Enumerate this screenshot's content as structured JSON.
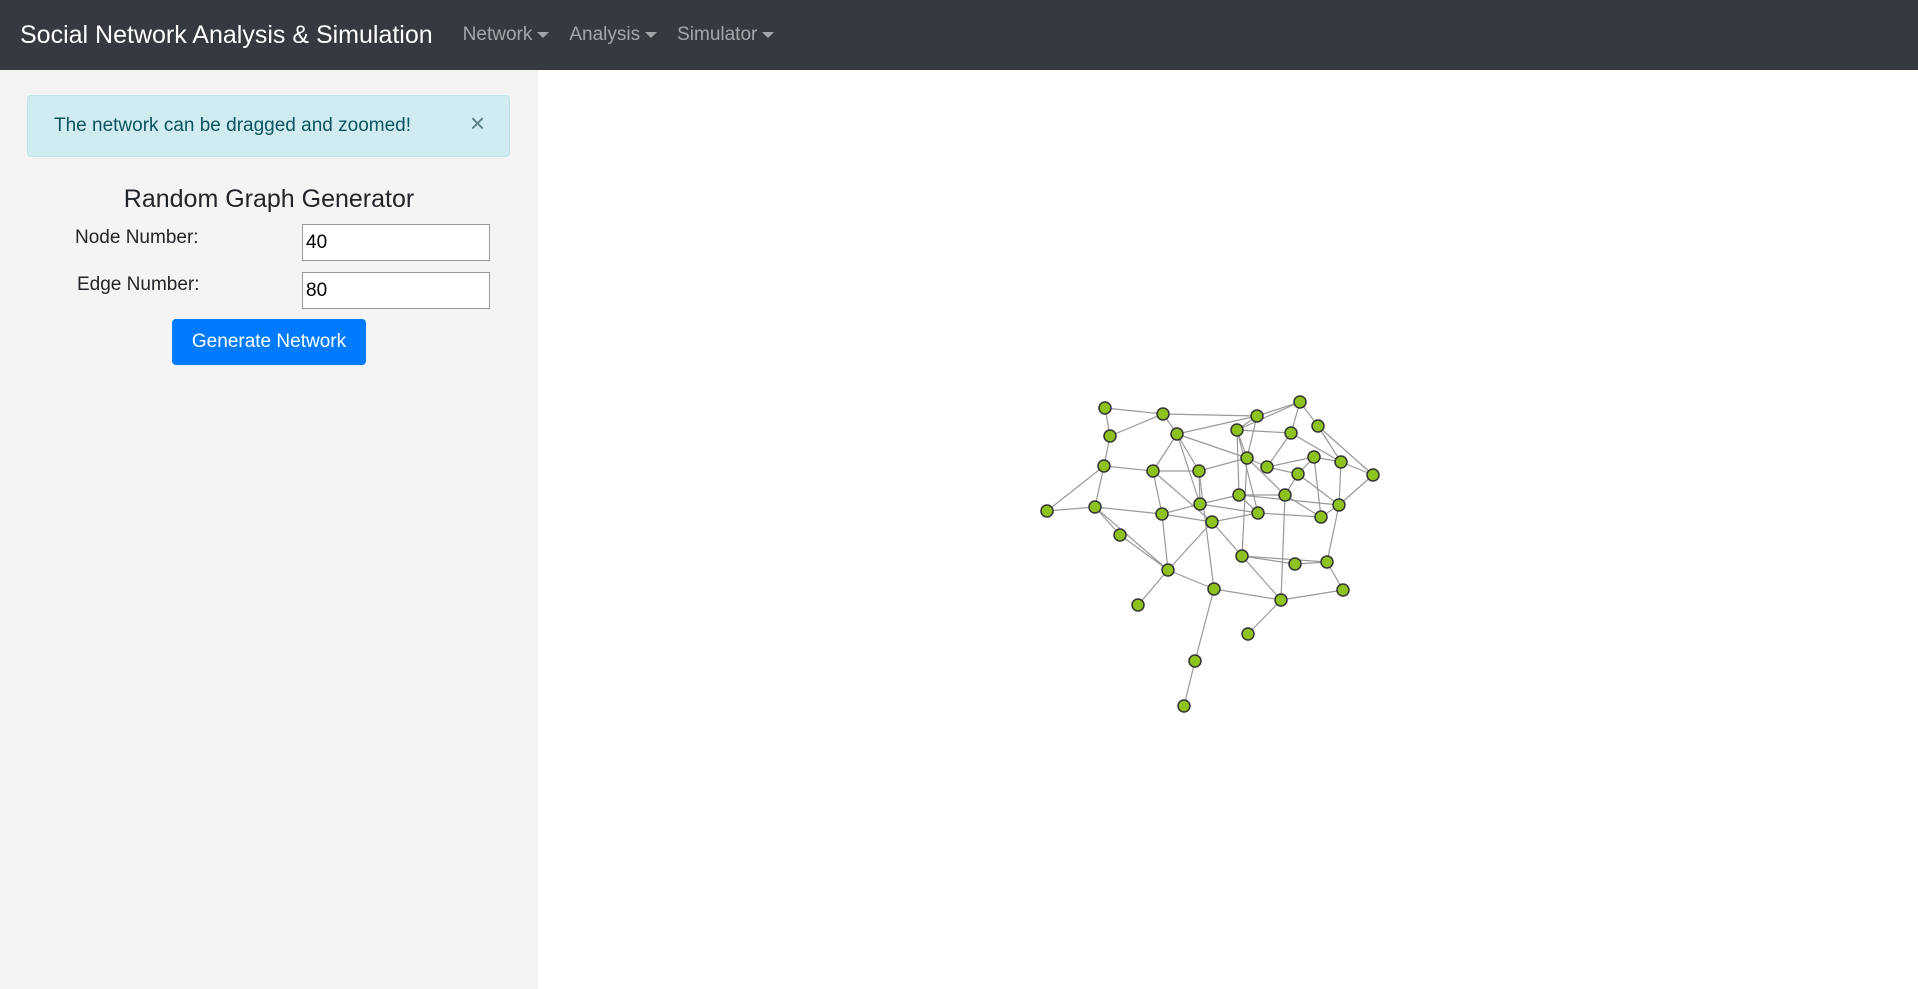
{
  "navbar": {
    "brand": "Social Network Analysis & Simulation",
    "menus": [
      {
        "label": "Network"
      },
      {
        "label": "Analysis"
      },
      {
        "label": "Simulator"
      }
    ]
  },
  "alert": {
    "message": "The network can be dragged and zoomed!",
    "close_glyph": "×"
  },
  "generator": {
    "title": "Random Graph Generator",
    "node_label": "Node Number:",
    "node_value": "40",
    "edge_label": "Edge Number:",
    "edge_value": "80",
    "button_label": "Generate Network"
  },
  "colors": {
    "navbar_bg": "#343a40",
    "sidebar_bg": "#f4f4f4",
    "alert_bg": "#d1ecf1",
    "button_bg": "#007bff",
    "node_fill": "#8dc21f",
    "node_stroke": "#333333",
    "edge": "#999999"
  }
}
